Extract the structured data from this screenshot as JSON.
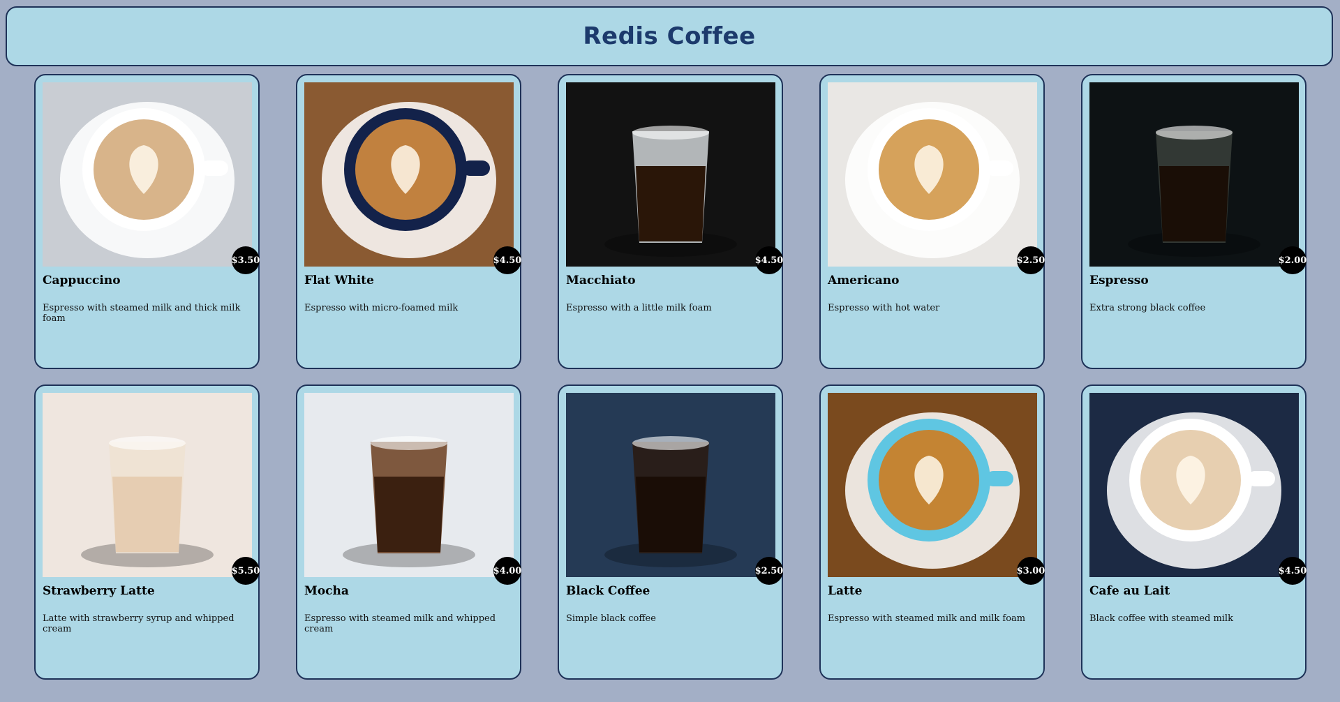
{
  "header": {
    "title": "Redis Coffee"
  },
  "products": [
    {
      "name": "Cappuccino",
      "description": "Espresso with steamed milk and thick milk foam",
      "price": "$3.50",
      "image": "cappuccino-photo",
      "bg": "#c9cdd3",
      "cup": "#ffffff",
      "drink": "#d8b48a"
    },
    {
      "name": "Flat White",
      "description": "Espresso with micro-foamed milk",
      "price": "$4.50",
      "image": "flat-white-photo",
      "bg": "#8a5a32",
      "cup": "#13224a",
      "drink": "#c1813f"
    },
    {
      "name": "Macchiato",
      "description": "Espresso with a little milk foam",
      "price": "$4.50",
      "image": "macchiato-photo",
      "bg": "#121212",
      "cup": "#cfd4d6",
      "drink": "#2a1608"
    },
    {
      "name": "Americano",
      "description": "Espresso with hot water",
      "price": "$2.50",
      "image": "americano-photo",
      "bg": "#e9e7e4",
      "cup": "#ffffff",
      "drink": "#d6a25b"
    },
    {
      "name": "Espresso",
      "description": "Extra strong black coffee",
      "price": "$2.00",
      "image": "espresso-photo",
      "bg": "#0d1214",
      "cup": "#3a3f3a",
      "drink": "#1a0e06"
    },
    {
      "name": "Strawberry Latte",
      "description": "Latte with strawberry syrup and whipped cream",
      "price": "$5.50",
      "image": "strawberry-latte-photo",
      "bg": "#efe6df",
      "cup": "#efe2d2",
      "drink": "#e6cdb2"
    },
    {
      "name": "Mocha",
      "description": "Espresso with steamed milk and whipped cream",
      "price": "$4.00",
      "image": "mocha-photo",
      "bg": "#e7eaee",
      "cup": "#6b3e1e",
      "drink": "#3b2010"
    },
    {
      "name": "Black Coffee",
      "description": "Simple black coffee",
      "price": "$2.50",
      "image": "black-coffee-photo",
      "bg": "#253a55",
      "cup": "#2a1a10",
      "drink": "#1a0d06"
    },
    {
      "name": "Latte",
      "description": "Espresso with steamed milk and milk foam",
      "price": "$3.00",
      "image": "latte-photo",
      "bg": "#7a4a1e",
      "cup": "#5fc6e2",
      "drink": "#c48433"
    },
    {
      "name": "Cafe au Lait",
      "description": "Black coffee with steamed milk",
      "price": "$4.50",
      "image": "cafe-au-lait-photo",
      "bg": "#1c2a44",
      "cup": "#ffffff",
      "drink": "#e7cfb0"
    }
  ]
}
